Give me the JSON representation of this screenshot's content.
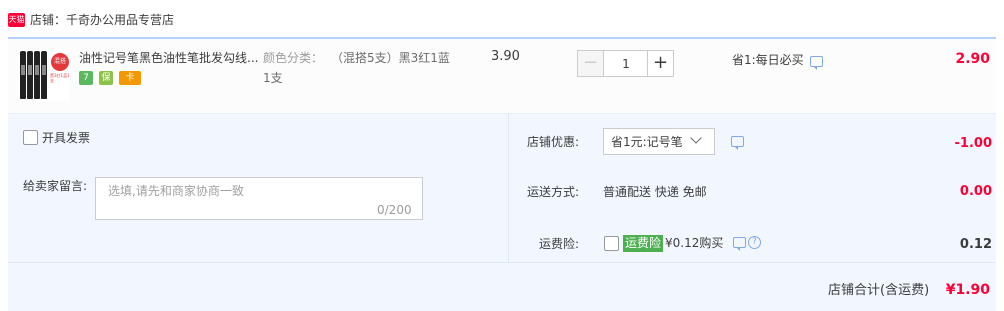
{
  "store": {
    "badge": "天猫",
    "label": "店铺：千奇办公用品专营店"
  },
  "item": {
    "title": "油性记号笔黑色油性笔批发勾线...",
    "thumb_tag": "混搭",
    "thumb_caption": "黑3红1蓝1支",
    "sku_label": "颜色分类：",
    "sku_value": "（混搭5支）黑3红1蓝",
    "sku_value_line2": "1支",
    "unit_price": "3.90",
    "quantity": "1",
    "qty_minus": "−",
    "qty_plus": "+",
    "promo": "省1:每日必买",
    "subtotal": "2.90",
    "service_icons": [
      "7",
      "保",
      "卡"
    ]
  },
  "options": {
    "invoice_label": "开具发票",
    "message_label": "给卖家留言:",
    "message_placeholder": "选填,请先和商家协商一致",
    "message_count": "0/200"
  },
  "summary": {
    "coupon_label": "店铺优惠:",
    "coupon_selected": "省1元:记号笔",
    "coupon_amount": "-1.00",
    "shipping_label": "运送方式:",
    "shipping_value": "普通配送 快递 免邮",
    "shipping_amount": "0.00",
    "insurance_label": "运费险:",
    "insurance_tag": "运费险",
    "insurance_price": "¥0.12购买",
    "insurance_amount": "0.12",
    "help_glyph": "?",
    "total_label": "店铺合计(含运费)",
    "total_amount": "¥1.90"
  },
  "colors": {
    "price_red": "#ff0036",
    "panel_bg": "#f2f7ff",
    "insurance_green": "#4caf50"
  }
}
